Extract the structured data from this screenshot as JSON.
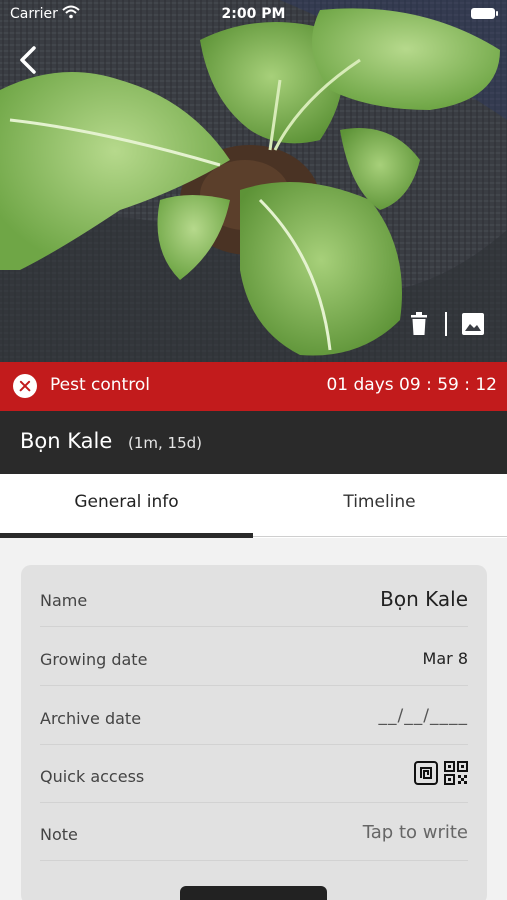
{
  "status_bar": {
    "carrier": "Carrier",
    "time": "2:00 PM",
    "wifi_icon": "wifi-icon",
    "battery_icon": "battery-icon"
  },
  "hero": {
    "back_icon": "chevron-left-icon",
    "delete_icon": "trash-icon",
    "gallery_icon": "image-icon"
  },
  "alert": {
    "icon": "close-circle-icon",
    "label": "Pest control",
    "countdown": "01 days 09 : 59 : 12",
    "color": "#c21b1c"
  },
  "plant": {
    "name": "Bọn Kale",
    "age": "(1m, 15d)"
  },
  "tabs": [
    {
      "label": "General info",
      "active": true
    },
    {
      "label": "Timeline",
      "active": false
    }
  ],
  "details": {
    "name_label": "Name",
    "name_value": "Bọn Kale",
    "growing_label": "Growing date",
    "growing_value": "Mar 8",
    "archive_label": "Archive date",
    "archive_value": "__/__/____",
    "quick_access_label": "Quick access",
    "quick_access_icons": [
      "nfc-tag-icon",
      "qr-code-icon"
    ],
    "note_label": "Note",
    "note_placeholder": "Tap to write"
  },
  "colors": {
    "title_band": "#2a2a2a",
    "card": "#e1e1e1",
    "page_bg": "#f2f2f2"
  }
}
